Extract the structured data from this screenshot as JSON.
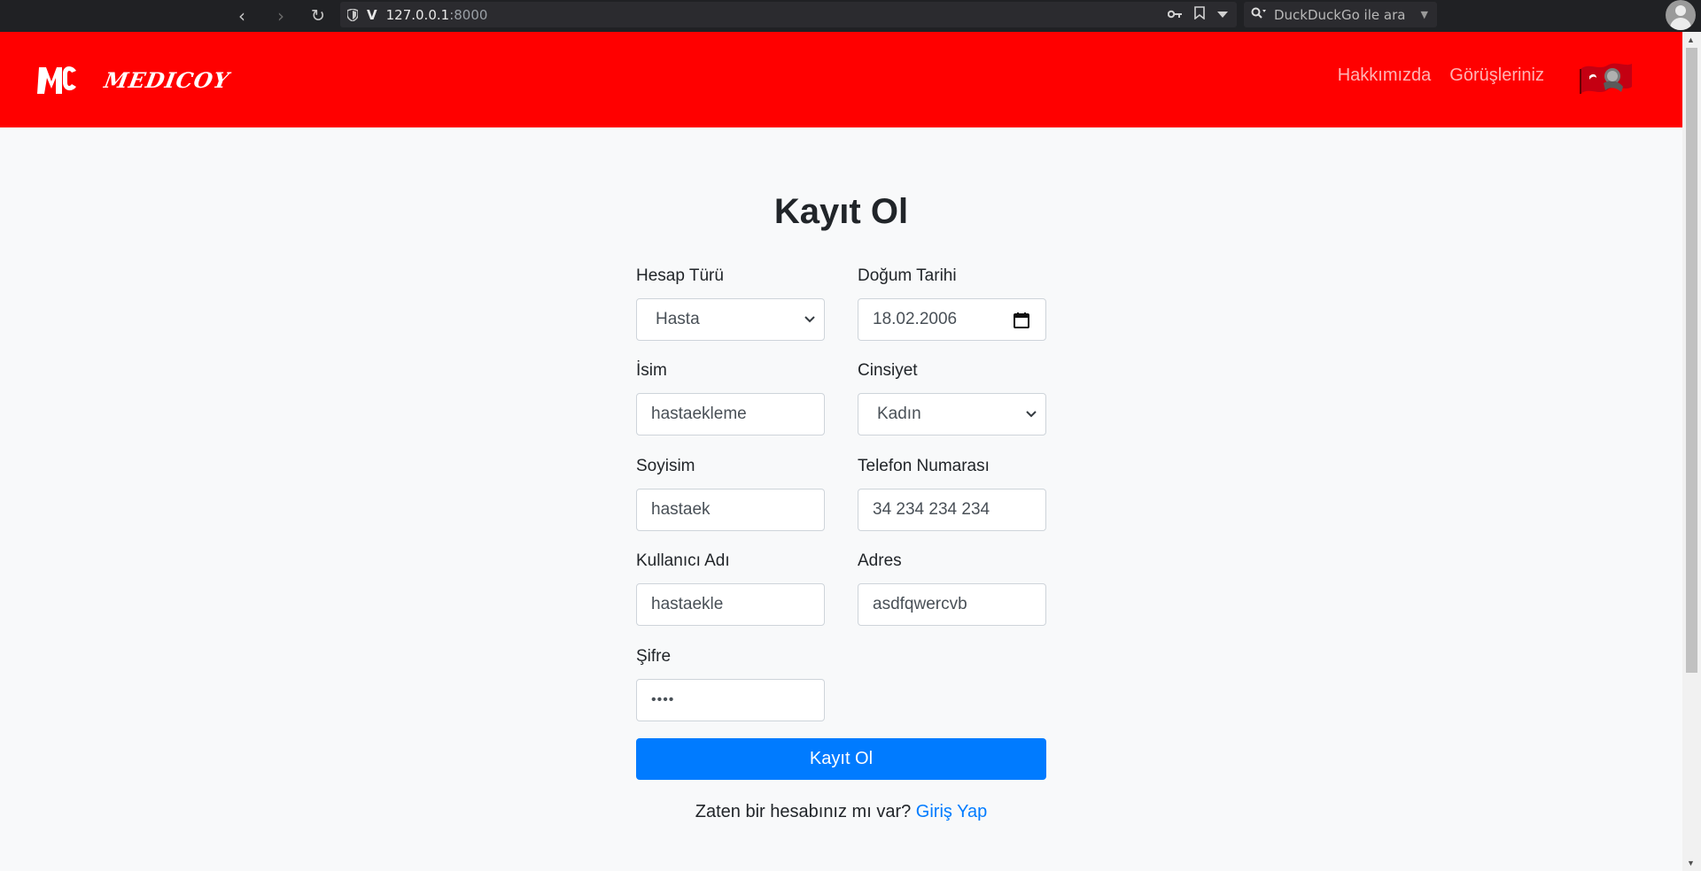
{
  "browser": {
    "url_host": "127.0.0.1",
    "url_port": ":8000",
    "search_placeholder": "DuckDuckGo ile ara"
  },
  "header": {
    "brand": "MEDICOY",
    "nav": [
      "Hakkımızda",
      "Görüşleriniz"
    ],
    "background": "#ff0000"
  },
  "form": {
    "title": "Kayıt Ol",
    "account_type": {
      "label": "Hesap Türü",
      "value": "Hasta"
    },
    "birth_date": {
      "label": "Doğum Tarihi",
      "value": "18.02.2006"
    },
    "first_name": {
      "label": "İsim",
      "value": "hastaekleme"
    },
    "gender": {
      "label": "Cinsiyet",
      "value": "Kadın"
    },
    "last_name": {
      "label": "Soyisim",
      "value": "hastaek"
    },
    "phone": {
      "label": "Telefon Numarası",
      "value": "34 234 234 234"
    },
    "username": {
      "label": "Kullanıcı Adı",
      "value": "hastaekle"
    },
    "address": {
      "label": "Adres",
      "value": "asdfqwercvb"
    },
    "password": {
      "label": "Şifre",
      "value": "••••"
    },
    "submit_label": "Kayıt Ol",
    "login_prompt": "Zaten bir hesabınız mı var?",
    "login_link": "Giriş Yap",
    "accent": "#007bff"
  }
}
